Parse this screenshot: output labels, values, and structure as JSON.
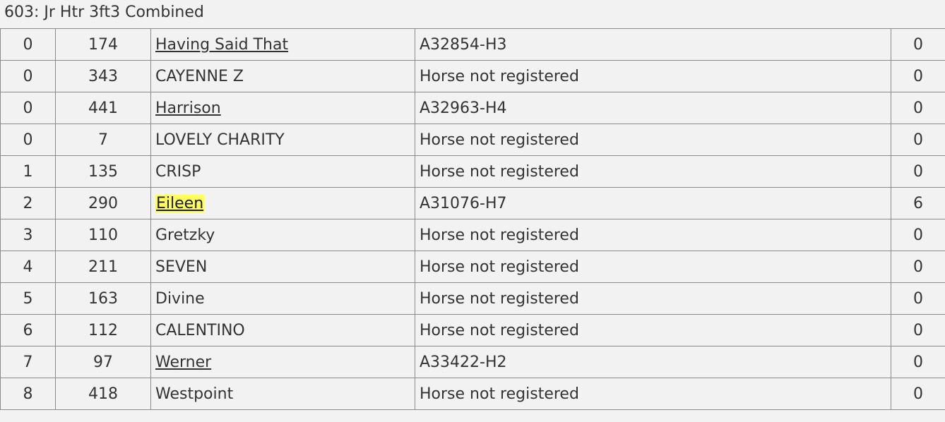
{
  "class_title": "603: Jr Htr 3ft3 Combined",
  "highlight_color": "#ffff5c",
  "rows": [
    {
      "place": "0",
      "number": "174",
      "horse": "Having Said That",
      "linked": true,
      "highlight": false,
      "registration": "A32854-H3",
      "points": "0"
    },
    {
      "place": "0",
      "number": "343",
      "horse": "CAYENNE Z",
      "linked": false,
      "highlight": false,
      "registration": "Horse not registered",
      "points": "0"
    },
    {
      "place": "0",
      "number": "441",
      "horse": "Harrison",
      "linked": true,
      "highlight": false,
      "registration": "A32963-H4",
      "points": "0"
    },
    {
      "place": "0",
      "number": "7",
      "horse": "LOVELY CHARITY",
      "linked": false,
      "highlight": false,
      "registration": "Horse not registered",
      "points": "0"
    },
    {
      "place": "1",
      "number": "135",
      "horse": "CRISP",
      "linked": false,
      "highlight": false,
      "registration": "Horse not registered",
      "points": "0"
    },
    {
      "place": "2",
      "number": "290",
      "horse": "Eileen",
      "linked": true,
      "highlight": true,
      "registration": "A31076-H7",
      "points": "6"
    },
    {
      "place": "3",
      "number": "110",
      "horse": "Gretzky",
      "linked": false,
      "highlight": false,
      "registration": "Horse not registered",
      "points": "0"
    },
    {
      "place": "4",
      "number": "211",
      "horse": "SEVEN",
      "linked": false,
      "highlight": false,
      "registration": "Horse not registered",
      "points": "0"
    },
    {
      "place": "5",
      "number": "163",
      "horse": "Divine",
      "linked": false,
      "highlight": false,
      "registration": "Horse not registered",
      "points": "0"
    },
    {
      "place": "6",
      "number": "112",
      "horse": "CALENTINO",
      "linked": false,
      "highlight": false,
      "registration": "Horse not registered",
      "points": "0"
    },
    {
      "place": "7",
      "number": "97",
      "horse": "Werner",
      "linked": true,
      "highlight": false,
      "registration": "A33422-H2",
      "points": "0"
    },
    {
      "place": "8",
      "number": "418",
      "horse": "Westpoint",
      "linked": false,
      "highlight": false,
      "registration": "Horse not registered",
      "points": "0"
    }
  ]
}
